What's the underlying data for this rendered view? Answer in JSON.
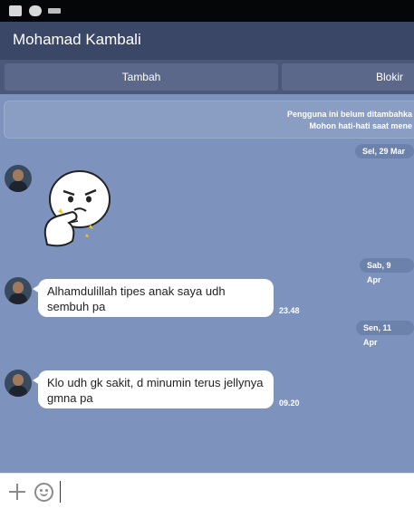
{
  "chat": {
    "contact_name": "Mohamad Kambali",
    "actions": {
      "add_label": "Tambah",
      "block_label": "Blokir"
    },
    "notice": {
      "line1": "Pengguna ini belum ditambahka",
      "line2": "Mohon hati-hati saat mene"
    },
    "dates": [
      "Sel, 29 Mar",
      "Sab, 9 Apr",
      "Sen, 11 Apr"
    ],
    "messages": [
      {
        "type": "sticker",
        "sticker_name": "thinking-brown-sticker"
      },
      {
        "type": "text",
        "text": "Alhamdulillah tipes anak saya udh sembuh pa",
        "time": "23.48"
      },
      {
        "type": "text",
        "text": "Klo udh gk sakit, d minumin terus jellynya gmna pa",
        "time": "09.20"
      }
    ]
  },
  "input": {
    "placeholder": "",
    "value": ""
  },
  "colors": {
    "status_bar": "#050608",
    "title_bar": "#3b4766",
    "action_bar": "#4b5878",
    "chat_background": "#7d93bd",
    "bubble": "#ffffff"
  },
  "icons": [
    "sim-icon",
    "line-icon",
    "keyboard-icon",
    "plus-icon",
    "emoji-icon"
  ]
}
